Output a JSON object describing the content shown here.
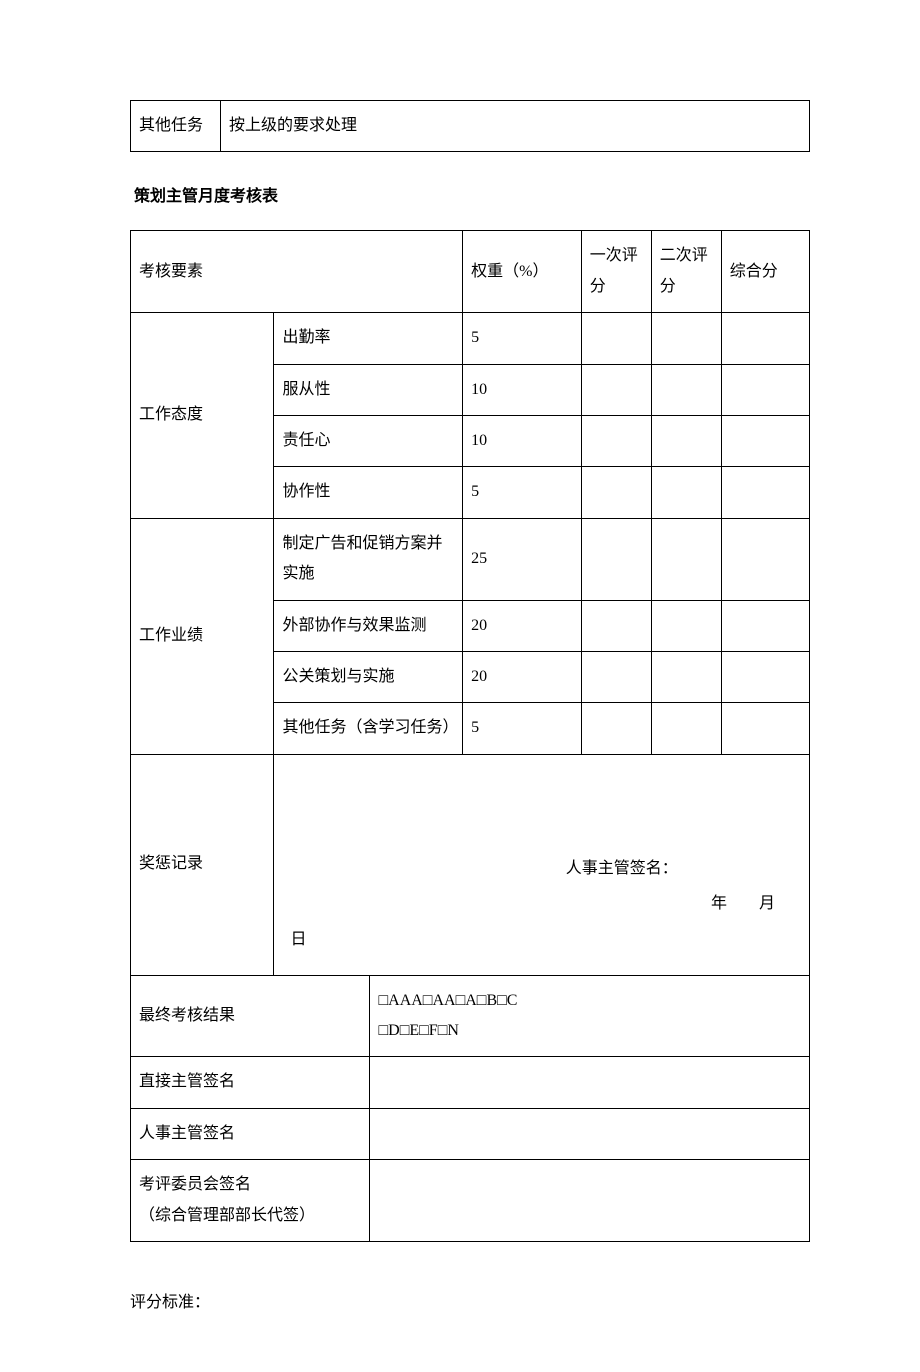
{
  "topTable": {
    "c1": "其他任务",
    "c2": "按上级的要求处理"
  },
  "title": "策划主管月度考核表",
  "header": {
    "element": "考核要素",
    "weight": "权重（%）",
    "score1": "一次评分",
    "score2": "二次评分",
    "total": "综合分"
  },
  "group1": {
    "name": "工作态度",
    "rows": [
      {
        "label": "出勤率",
        "weight": "5"
      },
      {
        "label": "服从性",
        "weight": "10"
      },
      {
        "label": "责任心",
        "weight": "10"
      },
      {
        "label": "协作性",
        "weight": "5"
      }
    ]
  },
  "group2": {
    "name": "工作业绩",
    "rows": [
      {
        "label": "制定广告和促销方案并实施",
        "weight": "25"
      },
      {
        "label": "外部协作与效果监测",
        "weight": "20"
      },
      {
        "label": "公关策划与实施",
        "weight": "20"
      },
      {
        "label": "其他任务（含学习任务）",
        "weight": "5"
      }
    ]
  },
  "reward": {
    "label": "奖惩记录",
    "sigLabel": "人事主管签名：",
    "dateYM": "年  月",
    "dateD": "日"
  },
  "final": {
    "label": "最终考核结果",
    "line1": "□AAA□AA□A□B□C",
    "line2": "□D□E□F□N"
  },
  "sig1": "直接主管签名",
  "sig2": "人事主管签名",
  "sig3a": "考评委员会签名",
  "sig3b": "（综合管理部部长代签）",
  "bottomNote": "评分标准："
}
